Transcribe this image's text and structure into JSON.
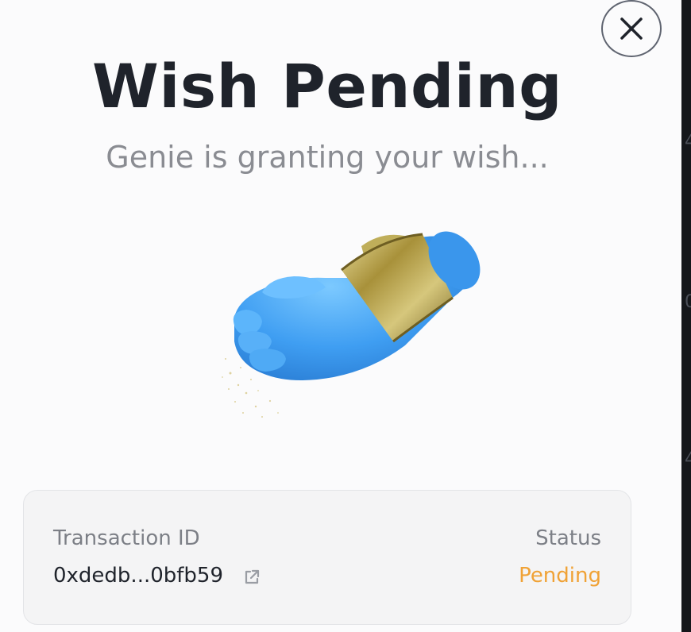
{
  "modal": {
    "title": "Wish Pending",
    "subtitle": "Genie is granting your wish..."
  },
  "icons": {
    "close": "close-icon",
    "external_link": "external-link-icon",
    "hero": "genie-hand-illustration"
  },
  "transaction": {
    "id_label": "Transaction ID",
    "id_value": "0xdedb...0bfb59",
    "status_label": "Status",
    "status_value": "Pending"
  },
  "colors": {
    "title": "#1f232b",
    "subtitle": "#8a8c92",
    "pending": "#f0a236",
    "hand": "#3f9ef2",
    "cuff": "#b8a24a"
  }
}
